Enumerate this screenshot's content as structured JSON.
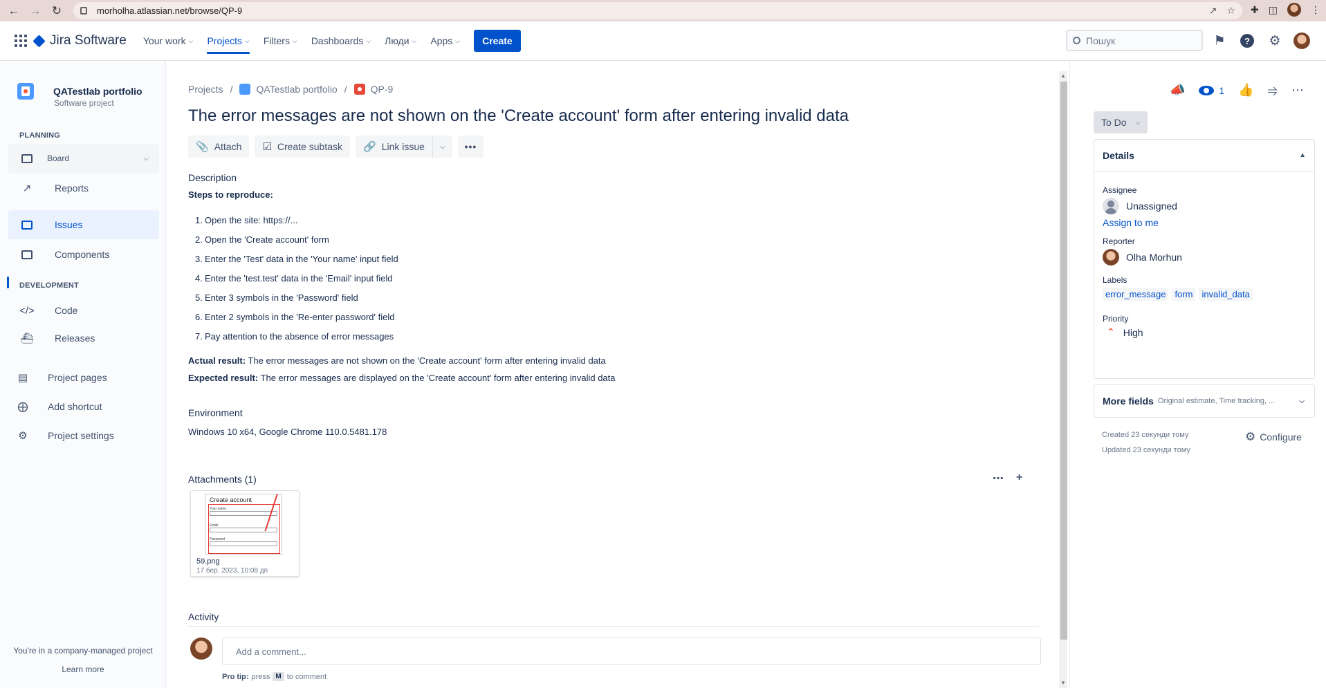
{
  "browser": {
    "url": "morholha.atlassian.net/browse/QP-9"
  },
  "topnav": {
    "logo": "Jira Software",
    "items": [
      {
        "label": "Your work"
      },
      {
        "label": "Projects"
      },
      {
        "label": "Filters"
      },
      {
        "label": "Dashboards"
      },
      {
        "label": "Люди"
      },
      {
        "label": "Apps"
      }
    ],
    "create_label": "Create",
    "search_placeholder": "Пошук"
  },
  "sidebar": {
    "project_name": "QATestlab portfolio",
    "project_type": "Software project",
    "planning_title": "PLANNING",
    "board_label": "Board",
    "reports_label": "Reports",
    "issues_label": "Issues",
    "components_label": "Components",
    "development_title": "DEVELOPMENT",
    "code_label": "Code",
    "releases_label": "Releases",
    "project_pages_label": "Project pages",
    "add_shortcut_label": "Add shortcut",
    "project_settings_label": "Project settings",
    "footer_text": "You're in a company-managed project",
    "learn_more": "Learn more"
  },
  "issue": {
    "breadcrumb": {
      "projects": "Projects",
      "project": "QATestlab portfolio",
      "key": "QP-9"
    },
    "title": "The error messages are not shown on the 'Create account' form after entering invalid data",
    "toolbar": {
      "attach": "Attach",
      "create_subtask": "Create subtask",
      "link_issue": "Link issue"
    },
    "description_title": "Description",
    "steps_title": "Steps to reproduce:",
    "steps": [
      "Open the site: https://...",
      "Open the 'Create account' form",
      "Enter the 'Test' data in the 'Your name' input field",
      "Enter the 'test.test' data in the 'Email' input field",
      "Enter 3 symbols in the 'Password' field",
      "Enter 2 symbols in the 'Re-enter password' field",
      "Pay attention to the absence of error messages"
    ],
    "actual_label": "Actual result:",
    "actual_text": "The error messages are not shown on the 'Create account' form after entering invalid data",
    "expected_label": "Expected result:",
    "expected_text": "The error messages are displayed on the 'Create account' form after entering invalid data",
    "environment_title": "Environment",
    "environment_text": "Windows 10 x64, Google Chrome 110.0.5481.178",
    "attachments_title": "Attachments (1)",
    "attachment": {
      "filename": "59.png",
      "date": "17 бер. 2023, 10:08 дп",
      "preview_title": "Create account",
      "preview_name_label": "Your name",
      "preview_email_label": "Email",
      "preview_password_label": "Password"
    },
    "activity_title": "Activity",
    "comment_placeholder": "Add a comment...",
    "pro_tip_label": "Pro tip:",
    "pro_tip_press": "press",
    "pro_tip_key": "M",
    "pro_tip_suffix": "to comment"
  },
  "panel": {
    "watch_count": "1",
    "status": "To Do",
    "details_title": "Details",
    "assignee_label": "Assignee",
    "assignee_value": "Unassigned",
    "assign_to_me": "Assign to me",
    "reporter_label": "Reporter",
    "reporter_value": "Olha Morhun",
    "labels_label": "Labels",
    "labels": [
      "error_message",
      "form",
      "invalid_data"
    ],
    "priority_label": "Priority",
    "priority_value": "High",
    "more_fields": "More fields",
    "more_fields_hint": "Original estimate, Time tracking, ...",
    "created": "Created 23 секунди тому",
    "updated": "Updated 23 секунди тому",
    "configure": "Configure"
  },
  "colors": {
    "brand": "#0052cc",
    "priority_high": "#ff5630",
    "bug": "#e5493a"
  }
}
